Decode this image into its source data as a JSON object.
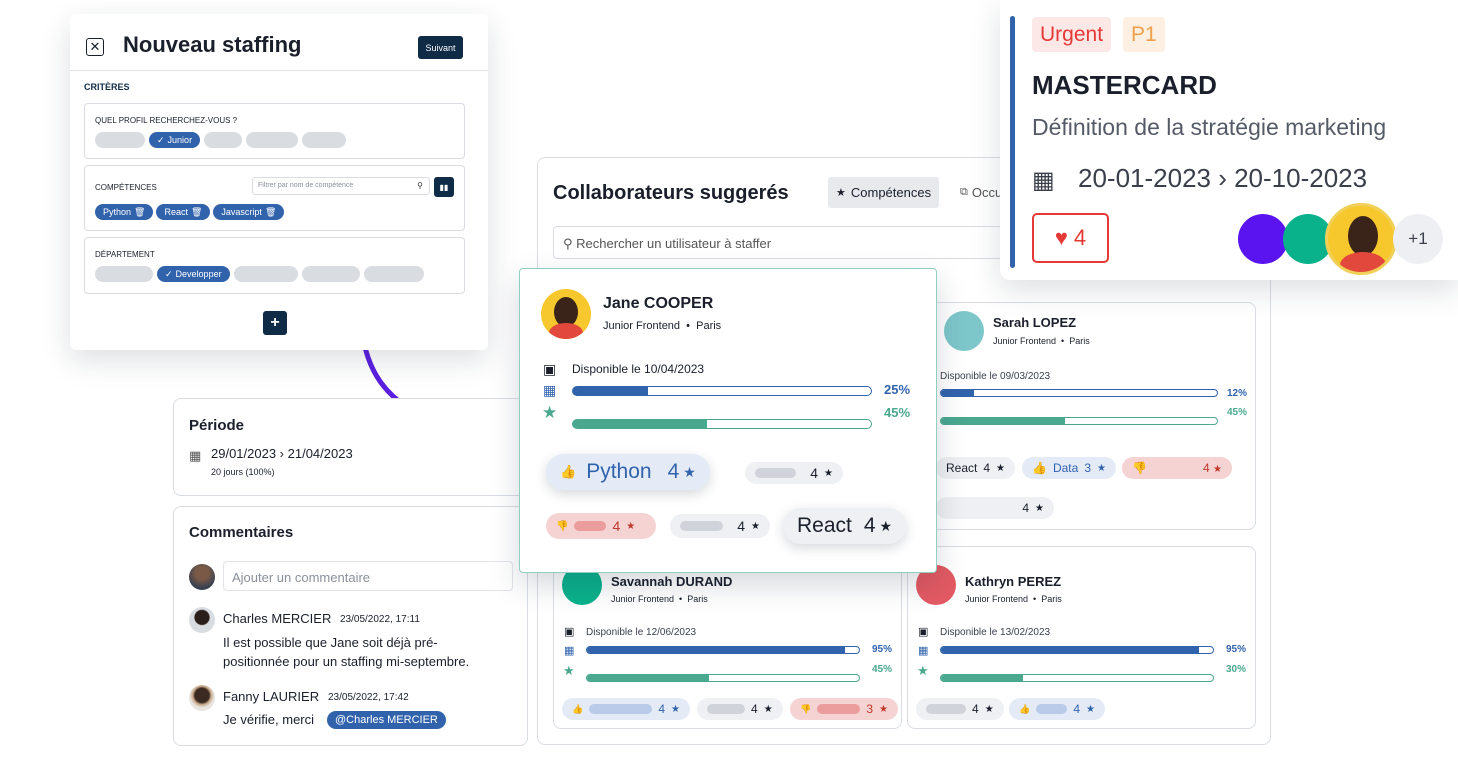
{
  "staffing": {
    "title": "Nouveau staffing",
    "next_label": "Suivant",
    "criteria_label": "CRITÈRES",
    "profile_label": "QUEL PROFIL RECHERCHEZ-VOUS ?",
    "profile_selected": "Junior",
    "skills_label": "COMPÉTENCES",
    "skills_filter_placeholder": "Filtrer par nom de compétence",
    "skill_tags": [
      "Python",
      "React",
      "Javascript"
    ],
    "department_label": "DÉPARTEMENT",
    "department_selected": "Developper",
    "add_label": "+"
  },
  "period": {
    "title": "Période",
    "range": "29/01/2023 › 21/04/2023",
    "duration": "20 jours (100%)"
  },
  "comments": {
    "title": "Commentaires",
    "placeholder": "Ajouter un commentaire",
    "items": [
      {
        "author": "Charles MERCIER",
        "date": "23/05/2022, 17:11",
        "text_line1": "Il est possible que Jane soit déjà pré-",
        "text_line2": "positionnée pour un staffing mi-septembre."
      },
      {
        "author": "Fanny LAURIER",
        "date": "23/05/2022, 17:42",
        "text": "Je vérifie, merci",
        "mention": "@Charles MERCIER"
      }
    ]
  },
  "suggested": {
    "title": "Collaborateurs suggerés",
    "tab_skills": "Compétences",
    "tab_occupation": "Occu",
    "search_placeholder": "Rechercher un utilisateur à staffer"
  },
  "jane": {
    "name": "Jane COOPER",
    "role": "Junior Frontend",
    "city": "Paris",
    "available": "Disponible le 10/04/2023",
    "pct1": "25%",
    "pct2": "45%",
    "fill1": 0.25,
    "fill2": 0.45,
    "skill_python": "Python",
    "skill_python_score": "4",
    "skill_gray_score": "4",
    "skill_red_score": "4",
    "skill_gray2_score": "4",
    "skill_react": "React",
    "skill_react_score": "4"
  },
  "sarah": {
    "name": "Sarah LOPEZ",
    "role": "Junior Frontend",
    "city": "Paris",
    "available": "Disponible le 09/03/2023",
    "pct1": "12%",
    "pct2": "45%",
    "fill1": 0.12,
    "fill2": 0.45,
    "skill_react": "React",
    "skill_react_score": "4",
    "skill_data": "Data",
    "skill_data_score": "3",
    "skill_red_score": "4",
    "skill_gray_score": "4"
  },
  "savannah": {
    "name": "Savannah DURAND",
    "role": "Junior Frontend",
    "city": "Paris",
    "available": "Disponible le 12/06/2023",
    "pct1": "95%",
    "pct2": "45%",
    "fill1": 0.95,
    "fill2": 0.45,
    "score_blue": "4",
    "score_gray": "4",
    "score_red": "3"
  },
  "kathryn": {
    "name": "Kathryn PEREZ",
    "role": "Junior Frontend",
    "city": "Paris",
    "available": "Disponible le 13/02/2023",
    "pct1": "95%",
    "pct2": "30%",
    "fill1": 0.95,
    "fill2": 0.3,
    "score_gray": "4",
    "score_blue": "4"
  },
  "mission": {
    "badge_urgent": "Urgent",
    "badge_priority": "P1",
    "client": "MASTERCARD",
    "description": "Définition de la stratégie marketing",
    "dates": "20-01-2023 › 20-10-2023",
    "likes": "4",
    "more_count": "+1"
  },
  "colors": {
    "primary": "#3163ad",
    "green": "#4aa88f",
    "dark": "#0f2b46",
    "urgent_red": "#e53935",
    "priority_orange": "#f0a04b",
    "arrow": "#5b1fe0"
  }
}
